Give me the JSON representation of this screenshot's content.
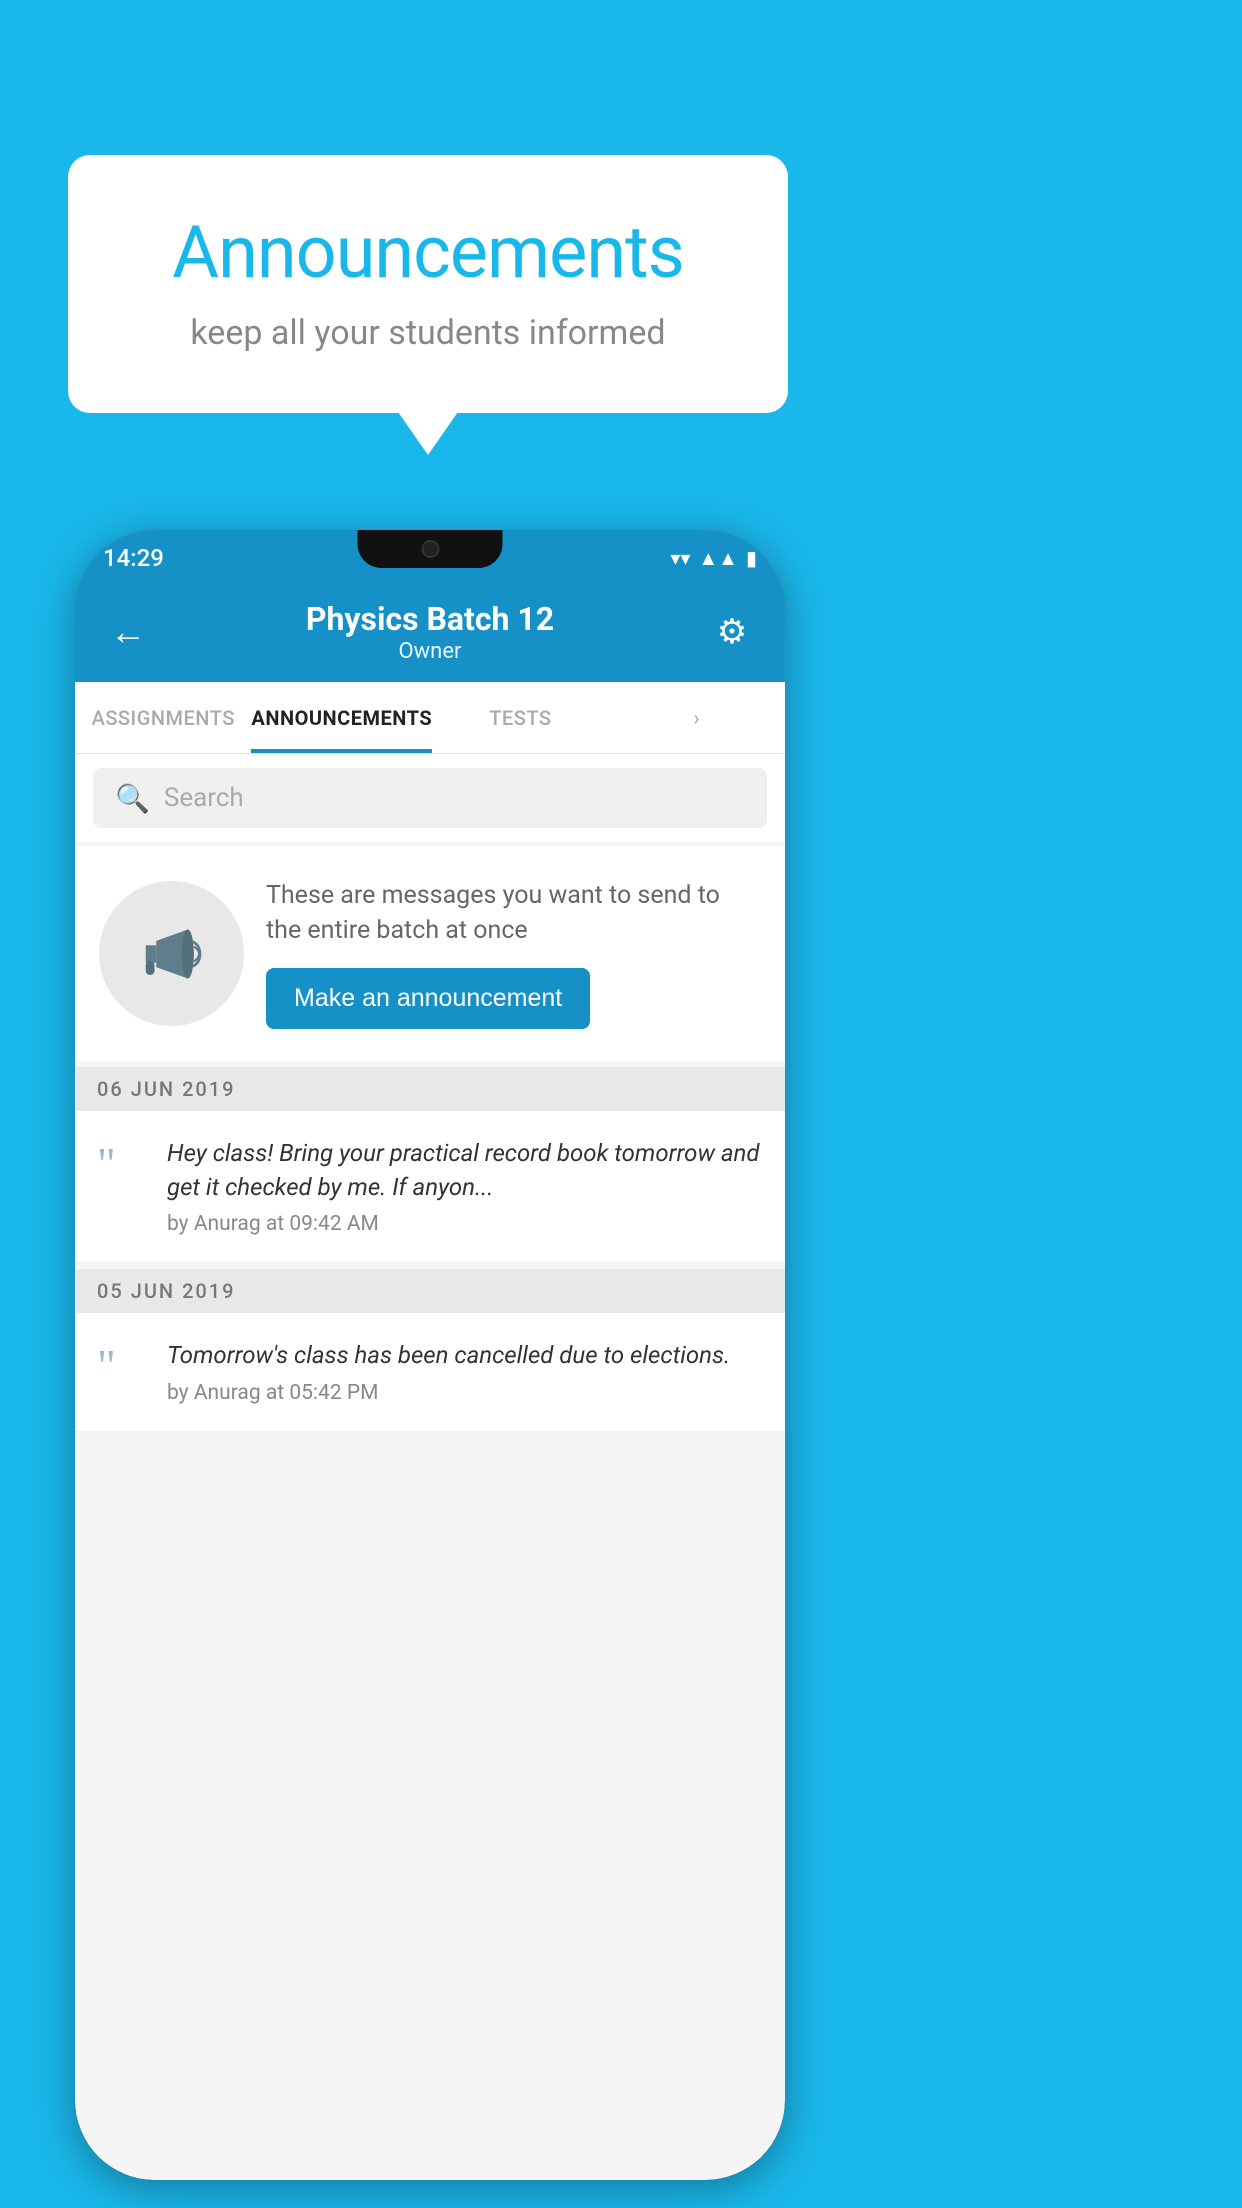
{
  "background_color": "#1ab7ea",
  "speech_bubble": {
    "title": "Announcements",
    "subtitle": "keep all your students informed"
  },
  "status_bar": {
    "time": "14:29",
    "icons": [
      "wifi",
      "signal",
      "battery"
    ]
  },
  "app_bar": {
    "back_label": "←",
    "title": "Physics Batch 12",
    "subtitle": "Owner",
    "gear_label": "⚙"
  },
  "tabs": [
    {
      "label": "ASSIGNMENTS",
      "active": false
    },
    {
      "label": "ANNOUNCEMENTS",
      "active": true
    },
    {
      "label": "TESTS",
      "active": false
    },
    {
      "label": "›",
      "active": false
    }
  ],
  "search": {
    "placeholder": "Search"
  },
  "promo": {
    "text": "These are messages you want to send to the entire batch at once",
    "button_label": "Make an announcement"
  },
  "announcements": [
    {
      "date": "06  JUN  2019",
      "items": [
        {
          "text": "Hey class! Bring your practical record book tomorrow and get it checked by me. If anyon...",
          "meta": "by Anurag at 09:42 AM"
        }
      ]
    },
    {
      "date": "05  JUN  2019",
      "items": [
        {
          "text": "Tomorrow's class has been cancelled due to elections.",
          "meta": "by Anurag at 05:42 PM"
        }
      ]
    }
  ]
}
